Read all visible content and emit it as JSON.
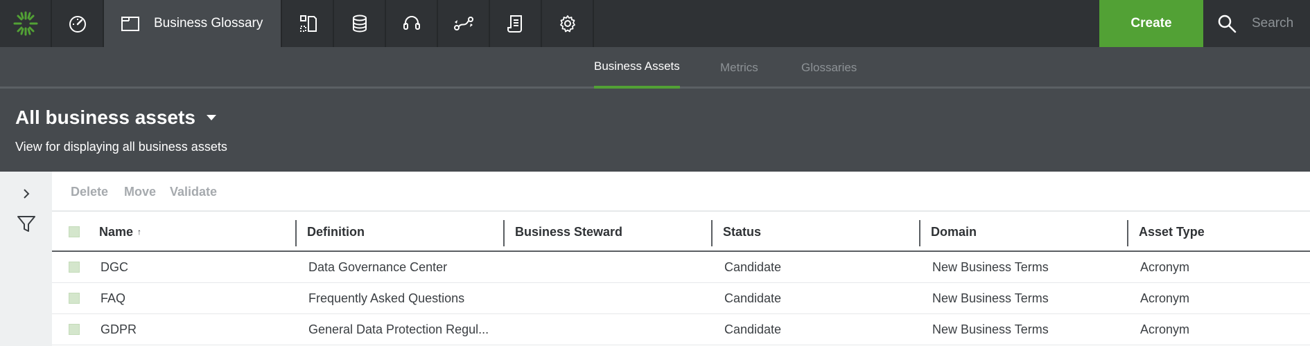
{
  "topbar": {
    "nav_icons": [
      "dashboard-icon",
      "business-glossary-icon",
      "data-dictionary-icon",
      "database-icon",
      "help-icon",
      "lineage-icon",
      "reports-icon",
      "settings-icon"
    ],
    "active_label": "Business Glossary",
    "create_label": "Create",
    "search_placeholder": "Search",
    "accent_color": "#52a135"
  },
  "subtabs": [
    {
      "label": "Business Assets",
      "active": true
    },
    {
      "label": "Metrics",
      "active": false
    },
    {
      "label": "Glossaries",
      "active": false
    }
  ],
  "view": {
    "title": "All business assets",
    "description": "View for displaying all business assets"
  },
  "toolbar": {
    "delete_label": "Delete",
    "move_label": "Move",
    "validate_label": "Validate"
  },
  "table": {
    "columns": [
      "Name",
      "Definition",
      "Business Steward",
      "Status",
      "Domain",
      "Asset Type"
    ],
    "sort_indicator": "↑",
    "rows": [
      {
        "name": "DGC",
        "definition": "Data Governance Center",
        "steward": "",
        "status": "Candidate",
        "domain": "New Business Terms",
        "type": "Acronym"
      },
      {
        "name": "FAQ",
        "definition": "Frequently Asked Questions",
        "steward": "",
        "status": "Candidate",
        "domain": "New Business Terms",
        "type": "Acronym"
      },
      {
        "name": "GDPR",
        "definition": "General Data Protection Regul...",
        "steward": "",
        "status": "Candidate",
        "domain": "New Business Terms",
        "type": "Acronym"
      }
    ]
  }
}
